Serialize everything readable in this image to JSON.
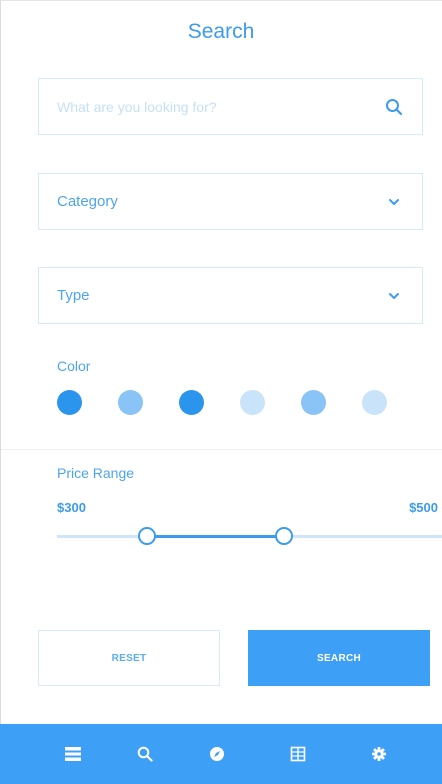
{
  "header": {
    "title": "Search"
  },
  "search": {
    "placeholder": "What are you looking for?"
  },
  "filters": {
    "category_label": "Category",
    "type_label": "Type"
  },
  "color": {
    "label": "Color",
    "swatches": [
      "#2b95ee",
      "#8ac3f5",
      "#2b95ee",
      "#c9e3fa",
      "#8ac3f5",
      "#c9e3fa"
    ]
  },
  "price_range": {
    "label": "Price Range",
    "min_label": "$300",
    "max_label": "$500",
    "lower_handle_fraction": 0.235,
    "upper_handle_fraction": 0.59
  },
  "actions": {
    "reset_label": "RESET",
    "search_label": "SEARCH"
  },
  "tabbar": {
    "items": [
      {
        "icon": "list-icon"
      },
      {
        "icon": "search-icon"
      },
      {
        "icon": "compass-icon"
      },
      {
        "icon": "grid-icon"
      },
      {
        "icon": "settings-icon"
      }
    ]
  },
  "theme": {
    "accent": "#3d9ff5",
    "border": "#d6eafb"
  }
}
